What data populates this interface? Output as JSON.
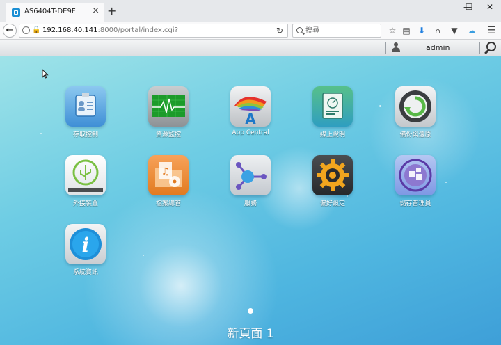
{
  "browser": {
    "tab_title": "AS6404T-DE9F",
    "tab_close": "×",
    "new_tab": "+",
    "window_controls": {
      "minimize": "—",
      "maximize": "☐",
      "close": "✕"
    },
    "url_host": "192.168.40.141",
    "url_rest": ":8000/portal/index.cgi?",
    "search_placeholder": "搜尋",
    "toolbar_icons": [
      "star-icon",
      "reader-icon",
      "download-icon",
      "home-icon",
      "pocket-icon",
      "cloud-icon",
      "menu-icon"
    ]
  },
  "adm_bar": {
    "username": "admin"
  },
  "desktop": {
    "apps": [
      {
        "id": "access-control",
        "label": "存取控制"
      },
      {
        "id": "activity-monitor",
        "label": "資源監控"
      },
      {
        "id": "app-central",
        "label": "App Central"
      },
      {
        "id": "online-help",
        "label": "線上說明"
      },
      {
        "id": "backup-restore",
        "label": "備份與還原"
      },
      {
        "id": "external-devices",
        "label": "外接裝置"
      },
      {
        "id": "file-explorer",
        "label": "檔案總管"
      },
      {
        "id": "services",
        "label": "服務"
      },
      {
        "id": "settings",
        "label": "偏好設定"
      },
      {
        "id": "storage-manager",
        "label": "儲存管理員"
      },
      {
        "id": "system-information",
        "label": "系統資訊"
      }
    ],
    "page_name": "新頁面 1"
  },
  "colors": {
    "desktop_top": "#9fe3e8",
    "desktop_bottom": "#3e9fd8"
  }
}
